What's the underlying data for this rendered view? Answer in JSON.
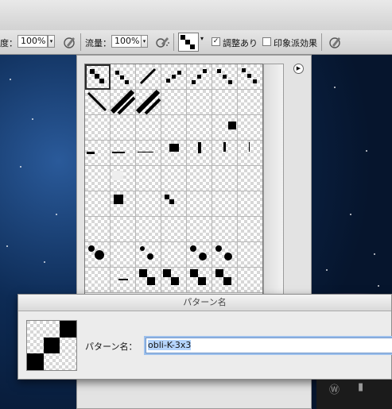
{
  "options_bar": {
    "opacity_label": "度：",
    "opacity_value": "100%",
    "flow_label": "流量：",
    "flow_value": "100%",
    "aligned_label": "調整あり",
    "aligned_checked": true,
    "impressionist_label": "印象派効果",
    "impressionist_checked": false
  },
  "picker": {
    "menu_icon": "circle-arrow-right-icon",
    "rows": 9,
    "columns": 7
  },
  "dialog": {
    "title": "パターン名",
    "name_label": "パターン名：",
    "name_value": "obli-K-3x3"
  },
  "icons": {
    "airbrush": "airbrush-icon",
    "tablet_pressure": "tablet-pressure-icon",
    "checkbox_checked": "✓"
  }
}
